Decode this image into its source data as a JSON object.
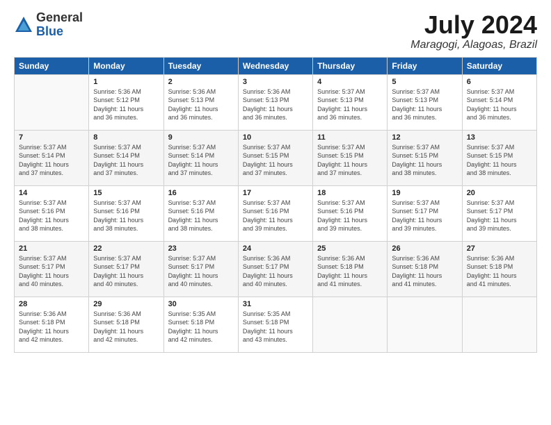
{
  "header": {
    "logo_line1": "General",
    "logo_line2": "Blue",
    "month": "July 2024",
    "location": "Maragogi, Alagoas, Brazil"
  },
  "weekdays": [
    "Sunday",
    "Monday",
    "Tuesday",
    "Wednesday",
    "Thursday",
    "Friday",
    "Saturday"
  ],
  "weeks": [
    [
      {
        "day": "",
        "info": ""
      },
      {
        "day": "1",
        "info": "Sunrise: 5:36 AM\nSunset: 5:12 PM\nDaylight: 11 hours\nand 36 minutes."
      },
      {
        "day": "2",
        "info": "Sunrise: 5:36 AM\nSunset: 5:13 PM\nDaylight: 11 hours\nand 36 minutes."
      },
      {
        "day": "3",
        "info": "Sunrise: 5:36 AM\nSunset: 5:13 PM\nDaylight: 11 hours\nand 36 minutes."
      },
      {
        "day": "4",
        "info": "Sunrise: 5:37 AM\nSunset: 5:13 PM\nDaylight: 11 hours\nand 36 minutes."
      },
      {
        "day": "5",
        "info": "Sunrise: 5:37 AM\nSunset: 5:13 PM\nDaylight: 11 hours\nand 36 minutes."
      },
      {
        "day": "6",
        "info": "Sunrise: 5:37 AM\nSunset: 5:14 PM\nDaylight: 11 hours\nand 36 minutes."
      }
    ],
    [
      {
        "day": "7",
        "info": "Sunrise: 5:37 AM\nSunset: 5:14 PM\nDaylight: 11 hours\nand 37 minutes."
      },
      {
        "day": "8",
        "info": "Sunrise: 5:37 AM\nSunset: 5:14 PM\nDaylight: 11 hours\nand 37 minutes."
      },
      {
        "day": "9",
        "info": "Sunrise: 5:37 AM\nSunset: 5:14 PM\nDaylight: 11 hours\nand 37 minutes."
      },
      {
        "day": "10",
        "info": "Sunrise: 5:37 AM\nSunset: 5:15 PM\nDaylight: 11 hours\nand 37 minutes."
      },
      {
        "day": "11",
        "info": "Sunrise: 5:37 AM\nSunset: 5:15 PM\nDaylight: 11 hours\nand 37 minutes."
      },
      {
        "day": "12",
        "info": "Sunrise: 5:37 AM\nSunset: 5:15 PM\nDaylight: 11 hours\nand 38 minutes."
      },
      {
        "day": "13",
        "info": "Sunrise: 5:37 AM\nSunset: 5:15 PM\nDaylight: 11 hours\nand 38 minutes."
      }
    ],
    [
      {
        "day": "14",
        "info": "Sunrise: 5:37 AM\nSunset: 5:16 PM\nDaylight: 11 hours\nand 38 minutes."
      },
      {
        "day": "15",
        "info": "Sunrise: 5:37 AM\nSunset: 5:16 PM\nDaylight: 11 hours\nand 38 minutes."
      },
      {
        "day": "16",
        "info": "Sunrise: 5:37 AM\nSunset: 5:16 PM\nDaylight: 11 hours\nand 38 minutes."
      },
      {
        "day": "17",
        "info": "Sunrise: 5:37 AM\nSunset: 5:16 PM\nDaylight: 11 hours\nand 39 minutes."
      },
      {
        "day": "18",
        "info": "Sunrise: 5:37 AM\nSunset: 5:16 PM\nDaylight: 11 hours\nand 39 minutes."
      },
      {
        "day": "19",
        "info": "Sunrise: 5:37 AM\nSunset: 5:17 PM\nDaylight: 11 hours\nand 39 minutes."
      },
      {
        "day": "20",
        "info": "Sunrise: 5:37 AM\nSunset: 5:17 PM\nDaylight: 11 hours\nand 39 minutes."
      }
    ],
    [
      {
        "day": "21",
        "info": "Sunrise: 5:37 AM\nSunset: 5:17 PM\nDaylight: 11 hours\nand 40 minutes."
      },
      {
        "day": "22",
        "info": "Sunrise: 5:37 AM\nSunset: 5:17 PM\nDaylight: 11 hours\nand 40 minutes."
      },
      {
        "day": "23",
        "info": "Sunrise: 5:37 AM\nSunset: 5:17 PM\nDaylight: 11 hours\nand 40 minutes."
      },
      {
        "day": "24",
        "info": "Sunrise: 5:36 AM\nSunset: 5:17 PM\nDaylight: 11 hours\nand 40 minutes."
      },
      {
        "day": "25",
        "info": "Sunrise: 5:36 AM\nSunset: 5:18 PM\nDaylight: 11 hours\nand 41 minutes."
      },
      {
        "day": "26",
        "info": "Sunrise: 5:36 AM\nSunset: 5:18 PM\nDaylight: 11 hours\nand 41 minutes."
      },
      {
        "day": "27",
        "info": "Sunrise: 5:36 AM\nSunset: 5:18 PM\nDaylight: 11 hours\nand 41 minutes."
      }
    ],
    [
      {
        "day": "28",
        "info": "Sunrise: 5:36 AM\nSunset: 5:18 PM\nDaylight: 11 hours\nand 42 minutes."
      },
      {
        "day": "29",
        "info": "Sunrise: 5:36 AM\nSunset: 5:18 PM\nDaylight: 11 hours\nand 42 minutes."
      },
      {
        "day": "30",
        "info": "Sunrise: 5:35 AM\nSunset: 5:18 PM\nDaylight: 11 hours\nand 42 minutes."
      },
      {
        "day": "31",
        "info": "Sunrise: 5:35 AM\nSunset: 5:18 PM\nDaylight: 11 hours\nand 43 minutes."
      },
      {
        "day": "",
        "info": ""
      },
      {
        "day": "",
        "info": ""
      },
      {
        "day": "",
        "info": ""
      }
    ]
  ]
}
